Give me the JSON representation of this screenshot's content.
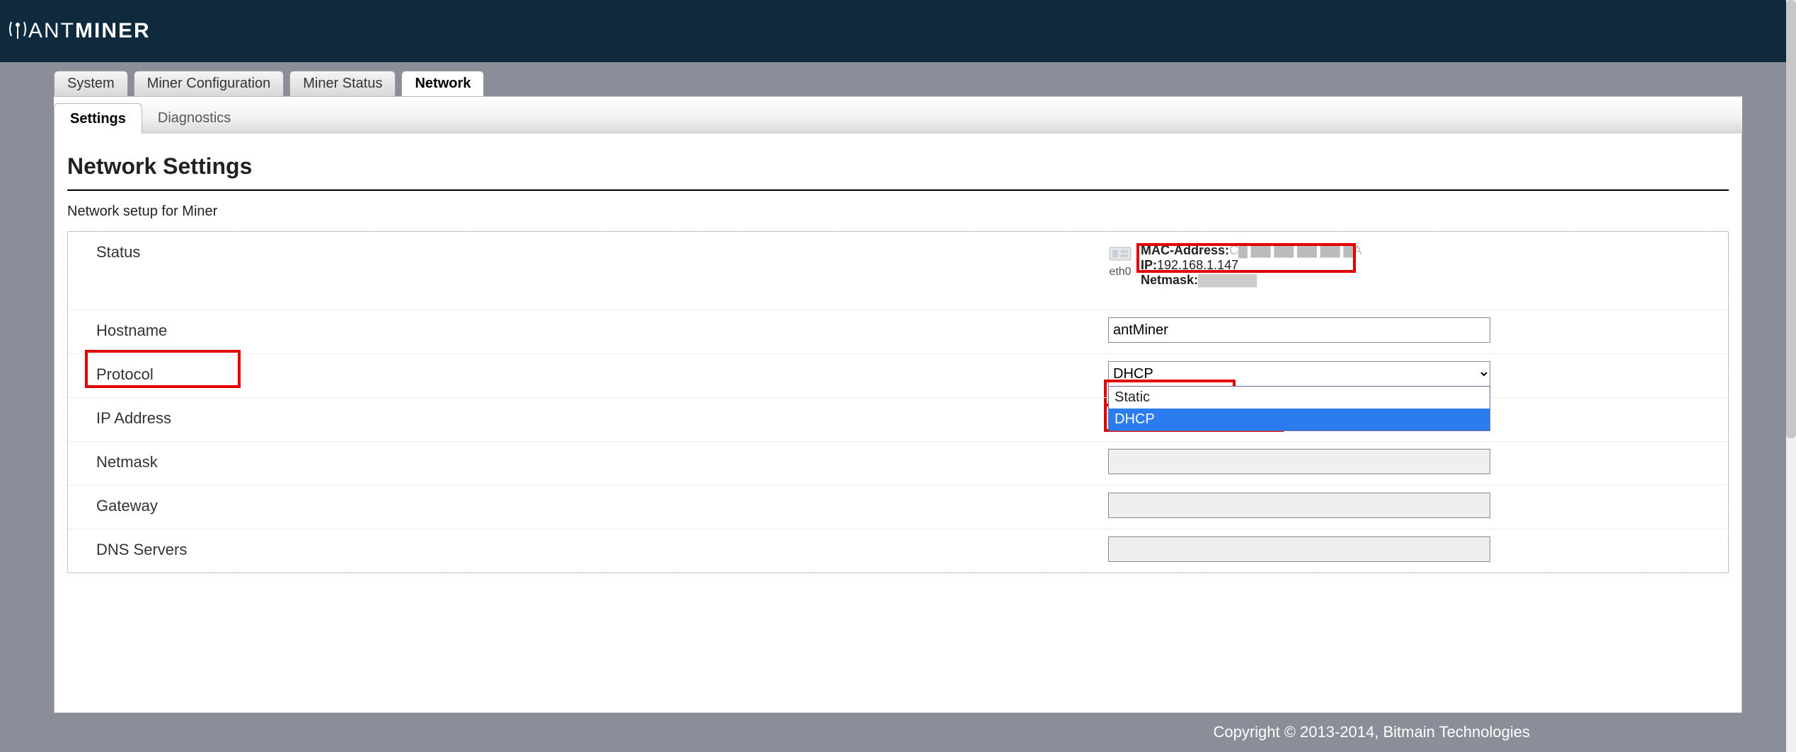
{
  "brand": {
    "ant": "ANT",
    "miner": "MINER"
  },
  "tabs_top": {
    "system": "System",
    "miner_config": "Miner Configuration",
    "miner_status": "Miner Status",
    "network": "Network"
  },
  "tabs_sub": {
    "settings": "Settings",
    "diagnostics": "Diagnostics"
  },
  "page": {
    "title": "Network Settings",
    "legend": "Network setup for Miner"
  },
  "rows": {
    "status": "Status",
    "hostname": "Hostname",
    "protocol": "Protocol",
    "ip": "IP Address",
    "netmask": "Netmask",
    "gateway": "Gateway",
    "dns": "DNS Servers"
  },
  "status": {
    "iface": "eth0",
    "mac_label": "MAC-Address:",
    "mac_value": "C█ ▇▇ ▇▇ ▇▇ ▇▇ ▇A",
    "ip_label": "IP:",
    "ip_value": "192.168.1.147",
    "mask_label": "Netmask:",
    "mask_value": "▇▇▇▇▇▇"
  },
  "values": {
    "hostname": "antMiner",
    "protocol_selected": "DHCP",
    "ip": "",
    "netmask": "",
    "gateway": "",
    "dns": ""
  },
  "protocol_options": {
    "static": "Static",
    "dhcp": "DHCP"
  },
  "footer": "Copyright © 2013-2014, Bitmain Technologies"
}
